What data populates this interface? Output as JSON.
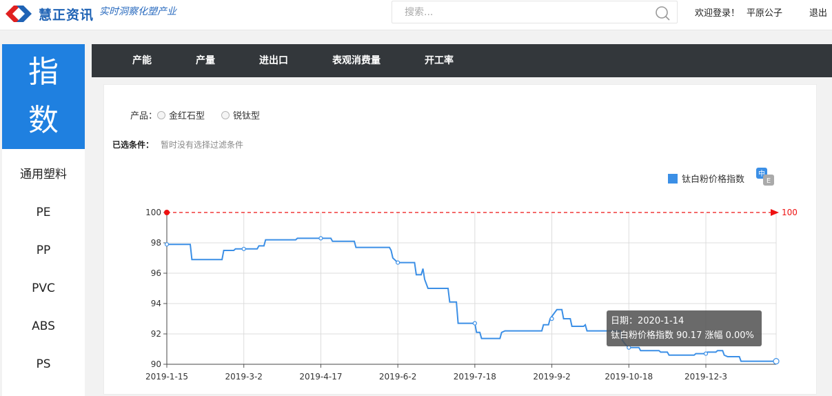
{
  "header": {
    "brand_name": "慧正资讯",
    "slogan": "实时洞察化塑产业",
    "search_placeholder": "搜索...",
    "welcome": "欢迎登录！",
    "username": "平原公子",
    "logout": "退出"
  },
  "sidebar": {
    "index_chars": [
      "指",
      "数"
    ],
    "items": [
      "通用塑料",
      "PE",
      "PP",
      "PVC",
      "ABS",
      "PS"
    ]
  },
  "nav": {
    "items": [
      "产能",
      "产量",
      "进出口",
      "表观消费量",
      "开工率"
    ]
  },
  "filters": {
    "product_label": "产品：",
    "options": [
      "金红石型",
      "锐钛型"
    ],
    "selected_label": "已选条件：",
    "selected_none": "暂时没有选择过滤条件"
  },
  "colors": {
    "accent": "#1f80e0",
    "series": "#3b8fe6",
    "markline": "#ee1111",
    "nav_bg": "#33373b"
  },
  "icons": {
    "search": "search-icon",
    "language": "language-toggle-icon"
  },
  "chart_data": {
    "type": "line",
    "title": "",
    "xlabel": "",
    "ylabel": "",
    "ylim": [
      90,
      100
    ],
    "yticks": [
      90,
      92,
      94,
      96,
      98,
      100
    ],
    "xticks": [
      "2019-1-15",
      "2019-3-2",
      "2019-4-17",
      "2019-6-2",
      "2019-7-18",
      "2019-9-2",
      "2019-10-18",
      "2019-12-3"
    ],
    "grid": true,
    "legend_position": "top-right",
    "series": [
      {
        "name": "钛白粉价格指数",
        "points": [
          [
            "2019-01-15",
            97.9
          ],
          [
            "2019-01-29",
            97.9
          ],
          [
            "2019-01-30",
            96.9
          ],
          [
            "2019-02-17",
            96.9
          ],
          [
            "2019-02-18",
            97.5
          ],
          [
            "2019-02-24",
            97.5
          ],
          [
            "2019-02-25",
            97.6
          ],
          [
            "2019-03-10",
            97.6
          ],
          [
            "2019-03-11",
            97.8
          ],
          [
            "2019-03-14",
            97.8
          ],
          [
            "2019-03-15",
            98.2
          ],
          [
            "2019-04-02",
            98.2
          ],
          [
            "2019-04-03",
            98.3
          ],
          [
            "2019-04-23",
            98.3
          ],
          [
            "2019-04-24",
            98.1
          ],
          [
            "2019-05-07",
            98.1
          ],
          [
            "2019-05-08",
            97.7
          ],
          [
            "2019-05-28",
            97.7
          ],
          [
            "2019-05-29",
            97.5
          ],
          [
            "2019-05-30",
            97.0
          ],
          [
            "2019-06-02",
            96.7
          ],
          [
            "2019-06-12",
            96.7
          ],
          [
            "2019-06-13",
            95.9
          ],
          [
            "2019-06-16",
            95.9
          ],
          [
            "2019-06-17",
            96.3
          ],
          [
            "2019-06-18",
            95.6
          ],
          [
            "2019-06-20",
            95.0
          ],
          [
            "2019-07-02",
            95.0
          ],
          [
            "2019-07-03",
            94.1
          ],
          [
            "2019-07-07",
            94.1
          ],
          [
            "2019-07-08",
            92.7
          ],
          [
            "2019-07-18",
            92.7
          ],
          [
            "2019-07-19",
            92.1
          ],
          [
            "2019-07-21",
            92.1
          ],
          [
            "2019-07-22",
            91.7
          ],
          [
            "2019-08-02",
            91.7
          ],
          [
            "2019-08-03",
            92.1
          ],
          [
            "2019-08-05",
            92.2
          ],
          [
            "2019-08-27",
            92.2
          ],
          [
            "2019-08-28",
            92.6
          ],
          [
            "2019-08-31",
            92.6
          ],
          [
            "2019-09-01",
            93.0
          ],
          [
            "2019-09-03",
            93.3
          ],
          [
            "2019-09-05",
            93.6
          ],
          [
            "2019-09-08",
            93.6
          ],
          [
            "2019-09-09",
            93.0
          ],
          [
            "2019-09-13",
            93.0
          ],
          [
            "2019-09-14",
            92.5
          ],
          [
            "2019-09-21",
            92.5
          ],
          [
            "2019-09-22",
            92.6
          ],
          [
            "2019-09-23",
            92.2
          ],
          [
            "2019-10-13",
            92.2
          ],
          [
            "2019-10-14",
            91.6
          ],
          [
            "2019-10-16",
            91.3
          ],
          [
            "2019-10-18",
            91.1
          ],
          [
            "2019-10-24",
            91.1
          ],
          [
            "2019-10-25",
            90.9
          ],
          [
            "2019-11-05",
            90.9
          ],
          [
            "2019-11-06",
            90.8
          ],
          [
            "2019-11-10",
            90.8
          ],
          [
            "2019-11-11",
            90.6
          ],
          [
            "2019-11-26",
            90.6
          ],
          [
            "2019-11-27",
            90.7
          ],
          [
            "2019-12-03",
            90.7
          ],
          [
            "2019-12-04",
            90.8
          ],
          [
            "2019-12-09",
            90.8
          ],
          [
            "2019-12-10",
            90.9
          ],
          [
            "2019-12-13",
            90.9
          ],
          [
            "2019-12-14",
            90.6
          ],
          [
            "2019-12-16",
            90.5
          ],
          [
            "2019-12-23",
            90.5
          ],
          [
            "2019-12-24",
            90.2
          ],
          [
            "2020-01-14",
            90.2
          ]
        ]
      }
    ],
    "markline": {
      "value": 100,
      "label": "100"
    },
    "tooltip": {
      "date_label": "日期：2020-1-14",
      "value_label": "钛白粉价格指数 90.17 涨幅 0.00%"
    }
  }
}
